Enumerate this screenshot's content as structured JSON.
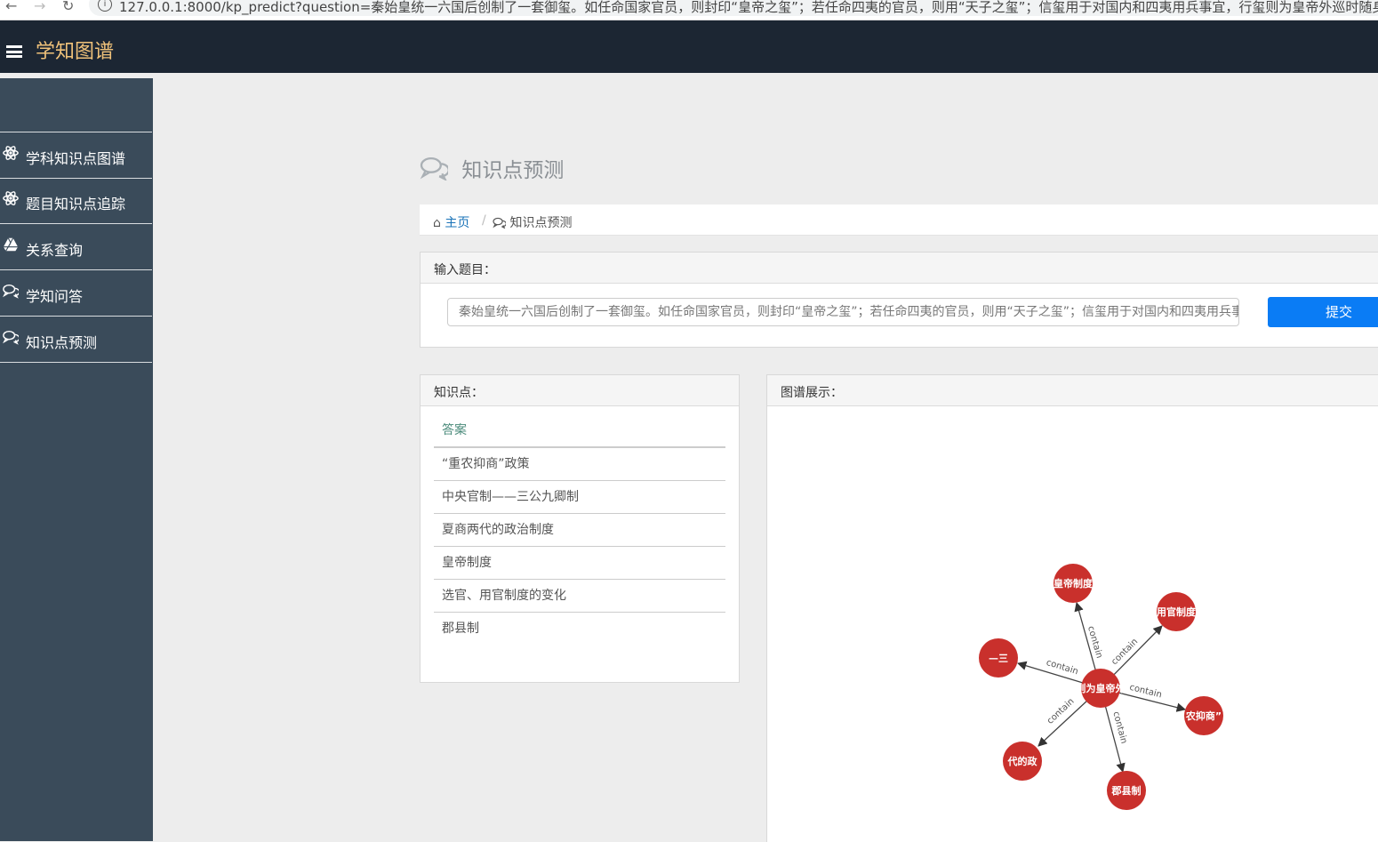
{
  "browser": {
    "url": "127.0.0.1:8000/kp_predict?question=秦始皇统一六国后创制了一套御玺。如任命国家官员，则封印“皇帝之玺”；若任命四夷的官员，则用“天子之玺”；信玺用于对国内和四夷用兵事宜，行玺则为皇帝外巡时随身携带。材料不能说"
  },
  "navbar": {
    "brand": "学知图谱"
  },
  "sidebar": {
    "items": [
      {
        "label": "学科知识点图谱",
        "icon": "atom-icon"
      },
      {
        "label": "题目知识点追踪",
        "icon": "atom-icon"
      },
      {
        "label": "关系查询",
        "icon": "google-drive-icon"
      },
      {
        "label": "学知问答",
        "icon": "chat-bubbles-icon"
      },
      {
        "label": "知识点预测",
        "icon": "chat-bubbles-icon"
      }
    ]
  },
  "page": {
    "title": "知识点预测",
    "breadcrumb": {
      "home": "主页",
      "separator": "/",
      "current": "知识点预测"
    }
  },
  "input_panel": {
    "header": "输入题目：",
    "question_value": "秦始皇统一六国后创制了一套御玺。如任命国家官员，则封印“皇帝之玺”；若任命四夷的官员，则用“天子之玺”；信玺用于对国内和四夷用兵事宜，行玺则为皇帝外巡时随身携带。材料不能说明",
    "submit_label": "提交"
  },
  "kp_panel": {
    "header": "知识点：",
    "column_header": "答案",
    "items": [
      "“重农抑商”政策",
      "中央官制——三公九卿制",
      "夏商两代的政治制度",
      "皇帝制度",
      "选官、用官制度的变化",
      "郡县制"
    ]
  },
  "graph_panel": {
    "header": "图谱展示：",
    "center_label": "则为皇帝外",
    "edge_label": "contain",
    "nodes": [
      "皇帝制度",
      "用官制度",
      "农抑商”",
      "郡县制",
      "代的政",
      "—三"
    ]
  },
  "colors": {
    "navbar_bg": "#1c2633",
    "brand": "#f0c27a",
    "sidebar_bg": "#3a4b5a",
    "primary_button": "#0a7cf5",
    "node_fill": "#c9302c",
    "link": "#1a73b8"
  }
}
